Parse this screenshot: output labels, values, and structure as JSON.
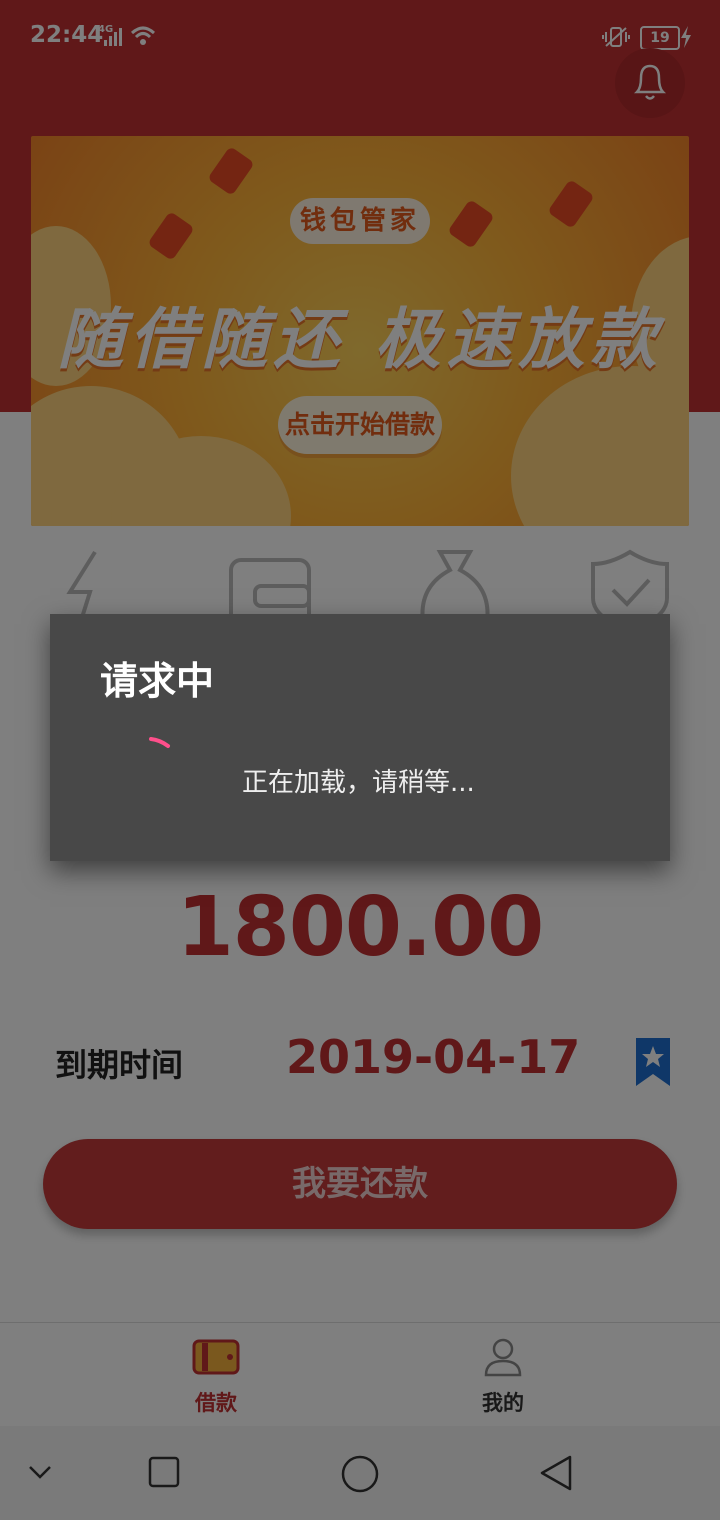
{
  "status_bar": {
    "time": "22:44",
    "network": "4G",
    "battery": "19"
  },
  "banner": {
    "brand": "钱包管家",
    "slogan": "随借随还 极速放款",
    "cta": "点击开始借款"
  },
  "loan": {
    "amount": "1800.00",
    "due_label": "到期时间",
    "due_date": "2019-04-17",
    "repay_button": "我要还款"
  },
  "tabs": [
    {
      "label": "借款",
      "active": true
    },
    {
      "label": "我的",
      "active": false
    }
  ],
  "dialog": {
    "title": "请求中",
    "message": "正在加载，请稍等..."
  },
  "colors": {
    "brand_red": "#c13032",
    "spinner": "#ff4f8b",
    "dialog_bg": "#484848"
  }
}
